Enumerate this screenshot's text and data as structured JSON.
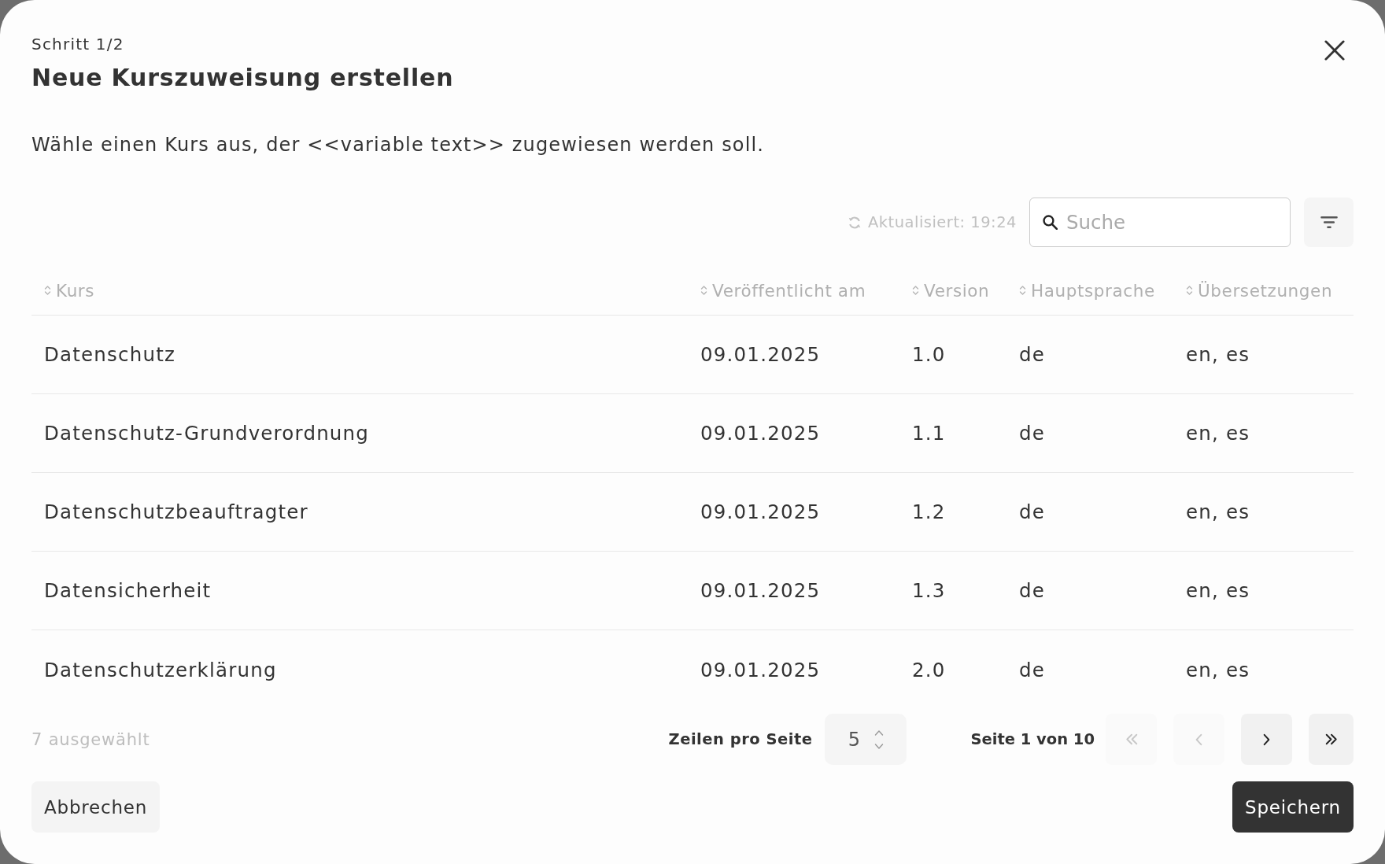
{
  "dialog": {
    "step": "Schritt 1/2",
    "title": "Neue Kurszuweisung erstellen",
    "description": "Wähle einen Kurs aus, der <<variable text>> zugewiesen werden soll."
  },
  "toolbar": {
    "updated": "Aktualisiert: 19:24",
    "search": {
      "placeholder": "Suche"
    }
  },
  "table": {
    "columns": [
      "Kurs",
      "Veröffentlicht am",
      "Version",
      "Hauptsprache",
      "Übersetzungen"
    ],
    "rows": [
      [
        "Datenschutz",
        "09.01.2025",
        "1.0",
        "de",
        "en, es"
      ],
      [
        "Datenschutz-Grundverordnung",
        "09.01.2025",
        "1.1",
        "de",
        "en, es"
      ],
      [
        "Datenschutzbeauftragter",
        "09.01.2025",
        "1.2",
        "de",
        "en, es"
      ],
      [
        "Datensicherheit",
        "09.01.2025",
        "1.3",
        "de",
        "en, es"
      ],
      [
        "Datenschutzerklärung",
        "09.01.2025",
        "2.0",
        "de",
        "en, es"
      ]
    ]
  },
  "footer": {
    "selected_count": "7 ausgewählt",
    "rows_per_page": {
      "label": "Zeilen pro Seite",
      "value": "5"
    },
    "page_info": "Seite 1 von 10",
    "pager": [
      {
        "kind": "first",
        "disabled": true
      },
      {
        "kind": "previous",
        "disabled": true
      },
      {
        "kind": "next",
        "disabled": false
      },
      {
        "kind": "last",
        "disabled": false
      }
    ]
  },
  "actions": [
    {
      "label": "Abbrechen",
      "kind": "secondary"
    },
    {
      "label": "Speichern",
      "kind": "primary"
    }
  ]
}
